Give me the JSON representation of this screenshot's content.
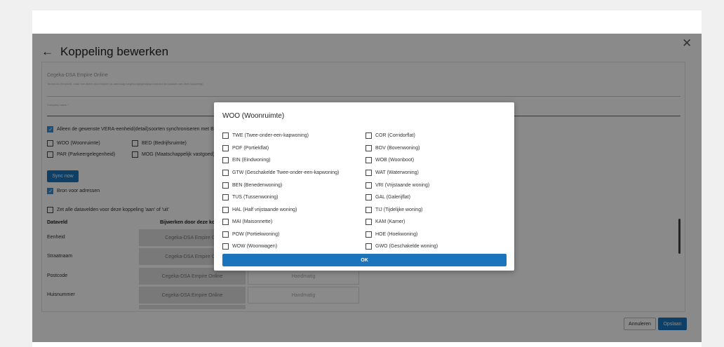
{
  "header": {
    "title": "Koppeling bewerken"
  },
  "connection": {
    "name": "Cegeka-DSA Empire Online",
    "hint": "Tenant-ID (Verplicht, maar kan alleen door Bryder na aanvraag toegevoegd/gewijzigd worden na opslaan van deze koppeling)",
    "company_label": "Company name *"
  },
  "sync_only": {
    "label": "Alleen de gewenste VERA-eenheid(detail)soorten synchroniseren met Bry",
    "checked": true,
    "types": [
      {
        "label": "WOO (Woonruimte)",
        "checked": false
      },
      {
        "label": "BED (Bedrijfsruimte)",
        "checked": false
      },
      {
        "label": "PAR (Parkeergelegenheid)",
        "checked": false
      },
      {
        "label": "MOG (Maatschappelijk vastgoed)",
        "checked": false
      }
    ]
  },
  "sync_button": "Sync now",
  "bron": {
    "label": "Bron voor adressen",
    "checked": true
  },
  "all_fields": {
    "label": "Zet alle datavelden voor deze koppeling 'aan' of 'uit'",
    "checked": false
  },
  "table": {
    "headers": [
      "Dataveld",
      "Bijwerken door deze kopp"
    ],
    "rows": [
      {
        "field": "Eenheid",
        "source": "Cegeka-DSA Empire Onl",
        "manual": ""
      },
      {
        "field": "Straatnaam",
        "source": "Cegeka-DSA Empire Onl",
        "manual": ""
      },
      {
        "field": "Postcode",
        "source": "Cegeka-DSA Empire Online",
        "manual": "Handmatig"
      },
      {
        "field": "Huisnummer",
        "source": "Cegeka-DSA Empire Online",
        "manual": "Handmatig"
      }
    ]
  },
  "footer": {
    "cancel": "Annuleren",
    "save": "Opslaan"
  },
  "modal": {
    "title": "WOO (Woonruimte)",
    "left_options": [
      "TWE (Twee-onder-een-kapwoning)",
      "POF (Portiekflat)",
      "EIN (Eindwoning)",
      "GTW (Geschakelde Twee-onder-een-kapwoning)",
      "BEN (Benedenwoning)",
      "TUS (Tussenwoning)",
      "HAL (Half vrijstaande woning)",
      "MAI (Maisonnette)",
      "POW (Portiekwoning)",
      "WOW (Woonwagen)"
    ],
    "right_options": [
      "COR (Corridorflat)",
      "BOV (Bovenwoning)",
      "WOB (Woonboot)",
      "WAT (Waterwoning)",
      "VRI (Vrijstaande woning)",
      "GAL (Galerijflat)",
      "TIJ (Tijdelijke woning)",
      "KAM (Kamer)",
      "HOE (Hoekwoning)",
      "GWO (Geschakelde woning)"
    ],
    "ok": "OK"
  },
  "colors": {
    "primary": "#1b75bc",
    "checkbox": "#3b8ccf"
  }
}
